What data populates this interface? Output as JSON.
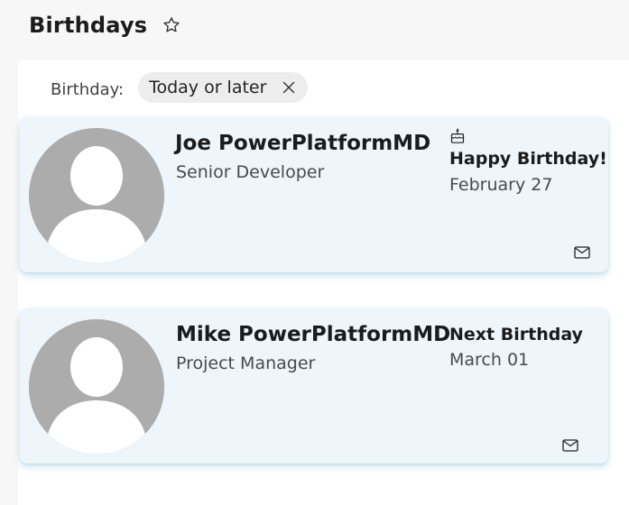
{
  "header": {
    "title": "Birthdays"
  },
  "filter": {
    "label": "Birthday:",
    "chip_label": "Today or later"
  },
  "cards": [
    {
      "name": "Joe PowerPlatformMD",
      "role": "Senior Developer",
      "status": "Happy Birthday!",
      "date": "February 27",
      "icon": "birthday-cake-icon"
    },
    {
      "name": "Mike PowerPlatformMD",
      "role": "Project Manager",
      "status": "Next Birthday",
      "date": "March 01"
    }
  ],
  "colors": {
    "card_background": "#eef5fb",
    "avatar_gray": "#acacac",
    "chip_background": "#ededed"
  }
}
